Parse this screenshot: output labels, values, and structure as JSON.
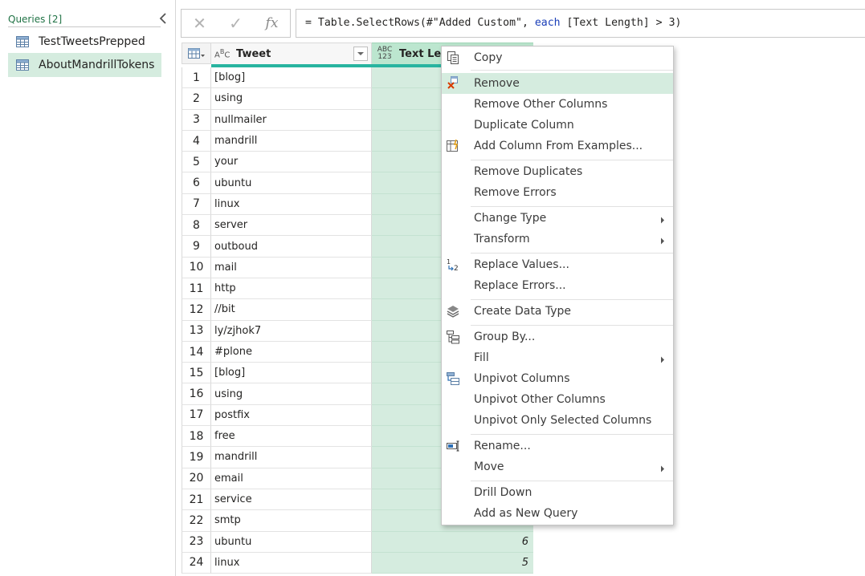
{
  "queries": {
    "header": "Queries [2]",
    "items": [
      {
        "label": "TestTweetsPrepped",
        "selected": false
      },
      {
        "label": "AboutMandrillTokens",
        "selected": true
      }
    ]
  },
  "formula_bar": {
    "cancel_icon": "✕",
    "commit_icon": "✓",
    "fx_label": "fx",
    "formula_prefix": "= Table.SelectRows(#\"Added Custom\", ",
    "formula_keyword": "each",
    "formula_suffix": " [Text Length] > 3)"
  },
  "grid": {
    "columns": [
      {
        "name": "Tweet",
        "type_label": "ABC"
      },
      {
        "name": "Text Length",
        "type_label_top": "ABC",
        "type_label_bottom": "123"
      }
    ],
    "rows": [
      {
        "num": "1",
        "tweet": "[blog]",
        "len": ""
      },
      {
        "num": "2",
        "tweet": "using",
        "len": ""
      },
      {
        "num": "3",
        "tweet": "nullmailer",
        "len": ""
      },
      {
        "num": "4",
        "tweet": "mandrill",
        "len": ""
      },
      {
        "num": "5",
        "tweet": "your",
        "len": ""
      },
      {
        "num": "6",
        "tweet": "ubuntu",
        "len": ""
      },
      {
        "num": "7",
        "tweet": "linux",
        "len": ""
      },
      {
        "num": "8",
        "tweet": "server",
        "len": ""
      },
      {
        "num": "9",
        "tweet": "outboud",
        "len": ""
      },
      {
        "num": "10",
        "tweet": "mail",
        "len": ""
      },
      {
        "num": "11",
        "tweet": "http",
        "len": ""
      },
      {
        "num": "12",
        "tweet": "//bit",
        "len": ""
      },
      {
        "num": "13",
        "tweet": "ly/zjhok7",
        "len": ""
      },
      {
        "num": "14",
        "tweet": "#plone",
        "len": ""
      },
      {
        "num": "15",
        "tweet": "[blog]",
        "len": ""
      },
      {
        "num": "16",
        "tweet": "using",
        "len": ""
      },
      {
        "num": "17",
        "tweet": "postfix",
        "len": ""
      },
      {
        "num": "18",
        "tweet": "free",
        "len": ""
      },
      {
        "num": "19",
        "tweet": "mandrill",
        "len": ""
      },
      {
        "num": "20",
        "tweet": "email",
        "len": ""
      },
      {
        "num": "21",
        "tweet": "service",
        "len": ""
      },
      {
        "num": "22",
        "tweet": "smtp",
        "len": ""
      },
      {
        "num": "23",
        "tweet": "ubuntu",
        "len": "6"
      },
      {
        "num": "24",
        "tweet": "linux",
        "len": "5"
      }
    ]
  },
  "context_menu": {
    "items": [
      {
        "label": "Copy",
        "icon": "copy-icon"
      },
      {
        "label": "Remove",
        "icon": "remove-column-icon",
        "hover": true
      },
      {
        "label": "Remove Other Columns"
      },
      {
        "label": "Duplicate Column"
      },
      {
        "label": "Add Column From Examples...",
        "icon": "add-column-examples-icon"
      },
      {
        "label": "Remove Duplicates"
      },
      {
        "label": "Remove Errors"
      },
      {
        "label": "Change Type",
        "submenu": true
      },
      {
        "label": "Transform",
        "submenu": true
      },
      {
        "label": "Replace Values...",
        "icon": "replace-values-icon"
      },
      {
        "label": "Replace Errors..."
      },
      {
        "label": "Create Data Type",
        "icon": "data-type-icon"
      },
      {
        "label": "Group By...",
        "icon": "group-by-icon"
      },
      {
        "label": "Fill",
        "submenu": true
      },
      {
        "label": "Unpivot Columns",
        "icon": "unpivot-icon"
      },
      {
        "label": "Unpivot Other Columns"
      },
      {
        "label": "Unpivot Only Selected Columns"
      },
      {
        "label": "Rename...",
        "icon": "rename-icon"
      },
      {
        "label": "Move",
        "submenu": true
      },
      {
        "label": "Drill Down"
      },
      {
        "label": "Add as New Query"
      }
    ]
  },
  "colors": {
    "accent_green": "#217346",
    "selection_green": "#d5ecdf",
    "header_green": "#bce6cf",
    "quality_teal": "#28b4a0",
    "keyword_blue": "#1b3fb8"
  }
}
